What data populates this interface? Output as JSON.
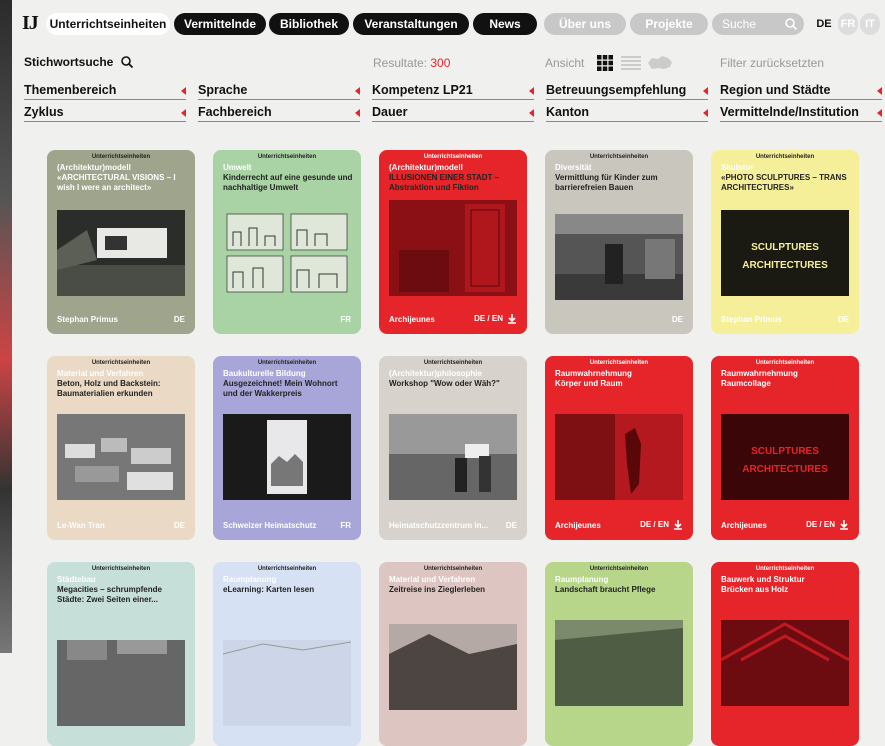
{
  "brand": {
    "logo": "IJ"
  },
  "nav": {
    "tabs": [
      {
        "label": "Unterrichtseinheiten"
      },
      {
        "label": "Vermittelnde"
      },
      {
        "label": "Bibliothek"
      },
      {
        "label": "Veranstaltungen"
      },
      {
        "label": "News"
      }
    ],
    "secondary": [
      {
        "label": "Über uns"
      },
      {
        "label": "Projekte"
      }
    ],
    "search": {
      "placeholder": "Suche"
    },
    "langs": [
      {
        "label": "DE",
        "active": true
      },
      {
        "label": "FR",
        "active": false
      },
      {
        "label": "IT",
        "active": false
      }
    ]
  },
  "toolbar": {
    "keyword_label": "Stichwortsuche",
    "results_label": "Resultate:",
    "results_count": "300",
    "view_label": "Ansicht",
    "reset_label": "Filter zurücksetzten"
  },
  "filters": [
    "Themenbereich",
    "Sprache",
    "Kompetenz LP21",
    "Betreuungsempfehlung",
    "Region und Städte",
    "Zyklus",
    "Fachbereich",
    "Dauer",
    "Kanton",
    "Vermittelnde/Institution"
  ],
  "colors": {
    "accent": "#e5252a",
    "olive": "#9ea58c",
    "green": "#a9d3a4",
    "red": "#e5252a",
    "grey": "#c9c6bd",
    "yellow": "#f6ef9a",
    "beige": "#ead9c4",
    "lilac": "#a8a6d8",
    "lightgrey": "#d7d3cc",
    "mint": "#c7dfd9",
    "paleblue": "#d6e1f3",
    "rose": "#ddc6c1",
    "lime": "#b7d68a"
  },
  "cards": [
    {
      "type": "Unterrichtseinheiten",
      "category": "(Architektur)modell",
      "title": "«ARCHITECTURAL VISIONS – I wish I were an architect»",
      "author": "Stephan Primus",
      "lang": "DE",
      "download": false
    },
    {
      "type": "Unterrichtseinheiten",
      "category": "Umwelt",
      "title": "Kinderrecht auf eine gesunde und nachhaltige Umwelt",
      "author": "",
      "lang": "FR",
      "download": false
    },
    {
      "type": "Unterrichtseinheiten",
      "category": "(Architektur)modell",
      "title": "ILLUSIONEN EINER STADT – Abstraktion und Fiktion",
      "author": "Archijeunes",
      "lang": "DE / EN",
      "download": true
    },
    {
      "type": "Unterrichtseinheiten",
      "category": "Diversität",
      "title": "Vermittlung für Kinder zum barrierefreien Bauen",
      "author": "",
      "lang": "DE",
      "download": false
    },
    {
      "type": "Unterrichtseinheiten",
      "category": "Skulptur",
      "title": "«PHOTO SCULPTURES – TRANS ARCHITECTURES»",
      "author": "Stephan Primus",
      "lang": "DE",
      "download": false,
      "img_text1": "SCULPTURES",
      "img_text2": "ARCHITECTURES"
    },
    {
      "type": "Unterrichtseinheiten",
      "category": "Material und Verfahren",
      "title": "Beton, Holz und Backstein: Baumaterialien erkunden",
      "author": "Le-Wan Tran",
      "lang": "DE",
      "download": false
    },
    {
      "type": "Unterrichtseinheiten",
      "category": "Baukulturelle Bildung",
      "title": "Ausgezeichnet! Mein Wohnort und der Wakkerpreis",
      "author": "Schweizer Heimatschutz",
      "lang": "FR",
      "download": false
    },
    {
      "type": "Unterrichtseinheiten",
      "category": "(Architektur)philosophie",
      "title": "Workshop \"Wow oder Wäh?\"",
      "author": "Heimatschutzzentrum in...",
      "lang": "DE",
      "download": false
    },
    {
      "type": "Unterrichtseinheiten",
      "category": "Raumwahrnehmung",
      "title": "Körper und Raum",
      "author": "Archijeunes",
      "lang": "DE / EN",
      "download": true
    },
    {
      "type": "Unterrichtseinheiten",
      "category": "Raumwahrnehmung",
      "title": "Raumcollage",
      "author": "Archijeunes",
      "lang": "DE / EN",
      "download": true,
      "img_text1": "SCULPTURES",
      "img_text2": "ARCHITECTURES"
    },
    {
      "type": "Unterrichtseinheiten",
      "category": "Städtebau",
      "title": "Megacities – schrumpfende Städte: Zwei Seiten einer...",
      "author": "",
      "lang": "",
      "download": false
    },
    {
      "type": "Unterrichtseinheiten",
      "category": "Raumplanung",
      "title": "eLearning: Karten lesen",
      "author": "",
      "lang": "",
      "download": false
    },
    {
      "type": "Unterrichtseinheiten",
      "category": "Material und Verfahren",
      "title": "Zeitreise ins Zieglerleben",
      "author": "",
      "lang": "",
      "download": false
    },
    {
      "type": "Unterrichtseinheiten",
      "category": "Raumplanung",
      "title": "Landschaft braucht Pflege",
      "author": "",
      "lang": "",
      "download": false
    },
    {
      "type": "Unterrichtseinheiten",
      "category": "Bauwerk und Struktur",
      "title": "Brücken aus Holz",
      "author": "",
      "lang": "",
      "download": false
    }
  ]
}
